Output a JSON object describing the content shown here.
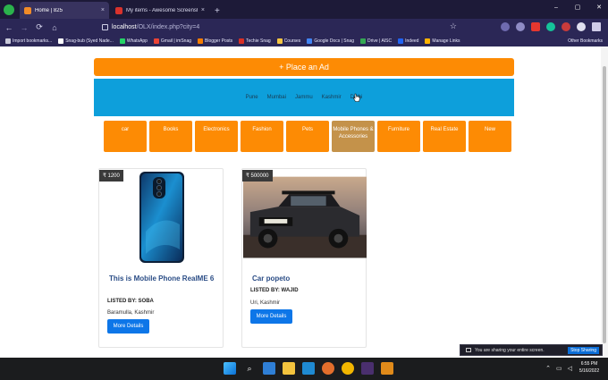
{
  "browser": {
    "tabs": [
      {
        "title": "Home | 825",
        "close": "×",
        "favicon_color": "#f28c28"
      },
      {
        "title": "My items - Awesome Screenshot",
        "close": "×",
        "favicon_color": "#d9322c"
      }
    ],
    "new_tab": "+",
    "nav": {
      "back": "←",
      "forward": "→",
      "reload": "⟳",
      "home": "⌂"
    },
    "url": {
      "host": "localhost",
      "path": "/OLX/index.php?city=4"
    },
    "bookmarks": [
      {
        "label": "Import bookmarks...",
        "color": "#c9c9d9"
      },
      {
        "label": "Snag-bub (Syed Nade...",
        "color": "#ffffff"
      },
      {
        "label": "WhatsApp",
        "color": "#25d366"
      },
      {
        "label": "Gmail | imSnag",
        "color": "#ea4335"
      },
      {
        "label": "Blogger Posts",
        "color": "#f57d00"
      },
      {
        "label": "Techie Snag",
        "color": "#d93025"
      },
      {
        "label": "Courses",
        "color": "#f4c542"
      },
      {
        "label": "Google Docs | Snag",
        "color": "#4285f4"
      },
      {
        "label": "Drive | AISC",
        "color": "#34a853"
      },
      {
        "label": "Indeed",
        "color": "#2164f3"
      },
      {
        "label": "Manage Links",
        "color": "#ffb300"
      }
    ],
    "other_bookmarks": "Other Bookmarks"
  },
  "page": {
    "place_ad": "+ Place an Ad",
    "cities": [
      "Pune",
      "Mumbai",
      "Jammu",
      "Kashmir",
      "Delhi"
    ],
    "categories": [
      {
        "label": "car"
      },
      {
        "label": "Books"
      },
      {
        "label": "Electronics"
      },
      {
        "label": "Fashion"
      },
      {
        "label": "Pets"
      },
      {
        "label": "Mobile Phones & Accessories",
        "active": true
      },
      {
        "label": "Furniture"
      },
      {
        "label": "Real Estate"
      },
      {
        "label": "New"
      }
    ],
    "listings": [
      {
        "price": "₹ 1200",
        "title": "This is Mobile Phone RealME 6",
        "seller": "LISTED BY: SOBA",
        "location": "Baramulla, Kashmir",
        "button": "More Details"
      },
      {
        "price": "₹ 500000",
        "title": "Car popeto",
        "seller": "LISTED BY: WAJID",
        "location": "Uri, Kashmir",
        "button": "More Details"
      }
    ]
  },
  "screen_share": {
    "message": "You are sharing your entire screen.",
    "stop": "Stop Sharing"
  },
  "taskbar": {
    "time": "6:55 PM",
    "date": "5/16/2022"
  },
  "colors": {
    "orange": "#fd8b04",
    "blue_bar": "#0d9fdb",
    "button_blue": "#0d76e8",
    "active_category": "#c4924a"
  }
}
